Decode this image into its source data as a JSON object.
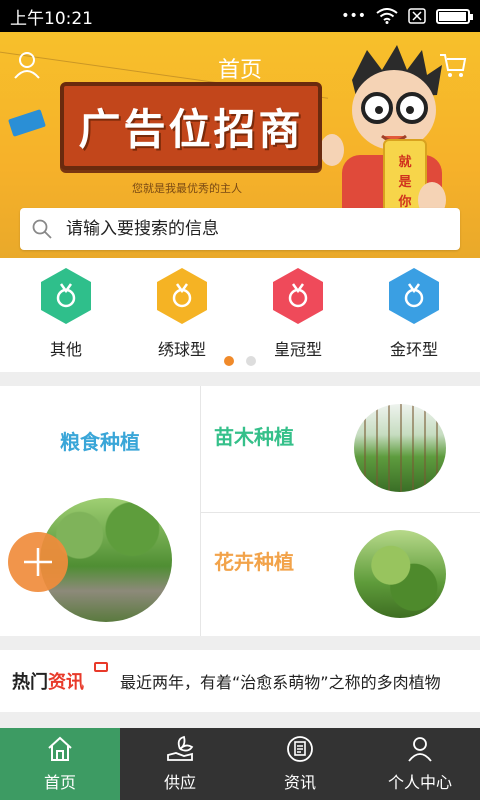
{
  "status_bar": {
    "time": "上午10:21"
  },
  "header": {
    "title": "首页"
  },
  "banner": {
    "ad_text": "广告位招商",
    "ad_subtitle": "您就是我最优秀的主人",
    "phone_text": "就是你啊"
  },
  "search": {
    "placeholder": "请输入要搜索的信息"
  },
  "categories": {
    "items": [
      {
        "label": "其他",
        "color": "#2fbf8b"
      },
      {
        "label": "绣球型",
        "color": "#f5b324"
      },
      {
        "label": "皇冠型",
        "color": "#ef4a5a"
      },
      {
        "label": "金环型",
        "color": "#3a9fe3"
      }
    ],
    "active_page": 1,
    "page_count": 2
  },
  "planting": {
    "grain": {
      "label": "粮食种植"
    },
    "sapling": {
      "label": "苗木种植"
    },
    "flower": {
      "label": "花卉种植"
    }
  },
  "news": {
    "badge_black": "热门",
    "badge_red": "资讯",
    "headline": "最近两年，有着“治愈系萌物”之称的多肉植物"
  },
  "tabbar": {
    "items": [
      {
        "label": "首页",
        "icon": "home-icon",
        "active": true
      },
      {
        "label": "供应",
        "icon": "supply-icon",
        "active": false
      },
      {
        "label": "资讯",
        "icon": "news-icon",
        "active": false
      },
      {
        "label": "个人中心",
        "icon": "person-icon",
        "active": false
      }
    ]
  },
  "colors": {
    "accent_green": "#3d9b63",
    "banner_yellow": "#f6b12a",
    "orange": "#f08a2a"
  }
}
